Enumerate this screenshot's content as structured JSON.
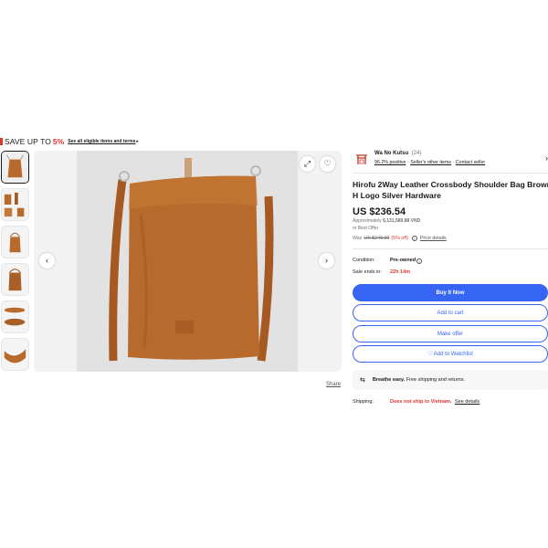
{
  "promo": {
    "prefix": "SAVE UP TO",
    "percent": "5%",
    "link": "See all eligible items and terms",
    "arrow": "▸"
  },
  "gallery": {
    "prev_icon": "‹",
    "next_icon": "›",
    "expand_icon": "⤢",
    "heart_icon": "♡",
    "share": "Share"
  },
  "seller": {
    "name": "Wa No Kutsu",
    "count": "(24)",
    "positive": "96.2% positive",
    "other_items": "Seller's other items",
    "contact": "Contact seller",
    "sep": "·",
    "chevron": "›"
  },
  "listing": {
    "title_line1": "Hirofu 2Way Leather Crossbody Shoulder Bag Brown",
    "title_line2": "H Logo Silver Hardware",
    "price": "US $236.54",
    "approx_prefix": "Approximately",
    "approx_value": "6,131,589.88 VND",
    "best_offer": "or Best Offer",
    "was_prefix": "Was",
    "was_price": "US $248.99",
    "discount": "(5% off)",
    "price_details": "Price details"
  },
  "details": {
    "condition_label": "Condition:",
    "condition_value": "Pre-owned",
    "sale_label": "Sale ends in:",
    "sale_value": "22h 14m"
  },
  "buttons": {
    "buy": "Buy It Now",
    "cart": "Add to cart",
    "offer": "Make offer",
    "watch": "♡ Add to Watchlist"
  },
  "breathe": {
    "bold": "Breathe easy.",
    "text": "Free shipping and returns."
  },
  "shipping": {
    "label": "Shipping:",
    "value": "Does not ship to Vietnam.",
    "link": "See details"
  },
  "colors": {
    "accent_blue": "#3665f3",
    "sale_red": "#e0362c",
    "leather": "#b86a2c"
  }
}
